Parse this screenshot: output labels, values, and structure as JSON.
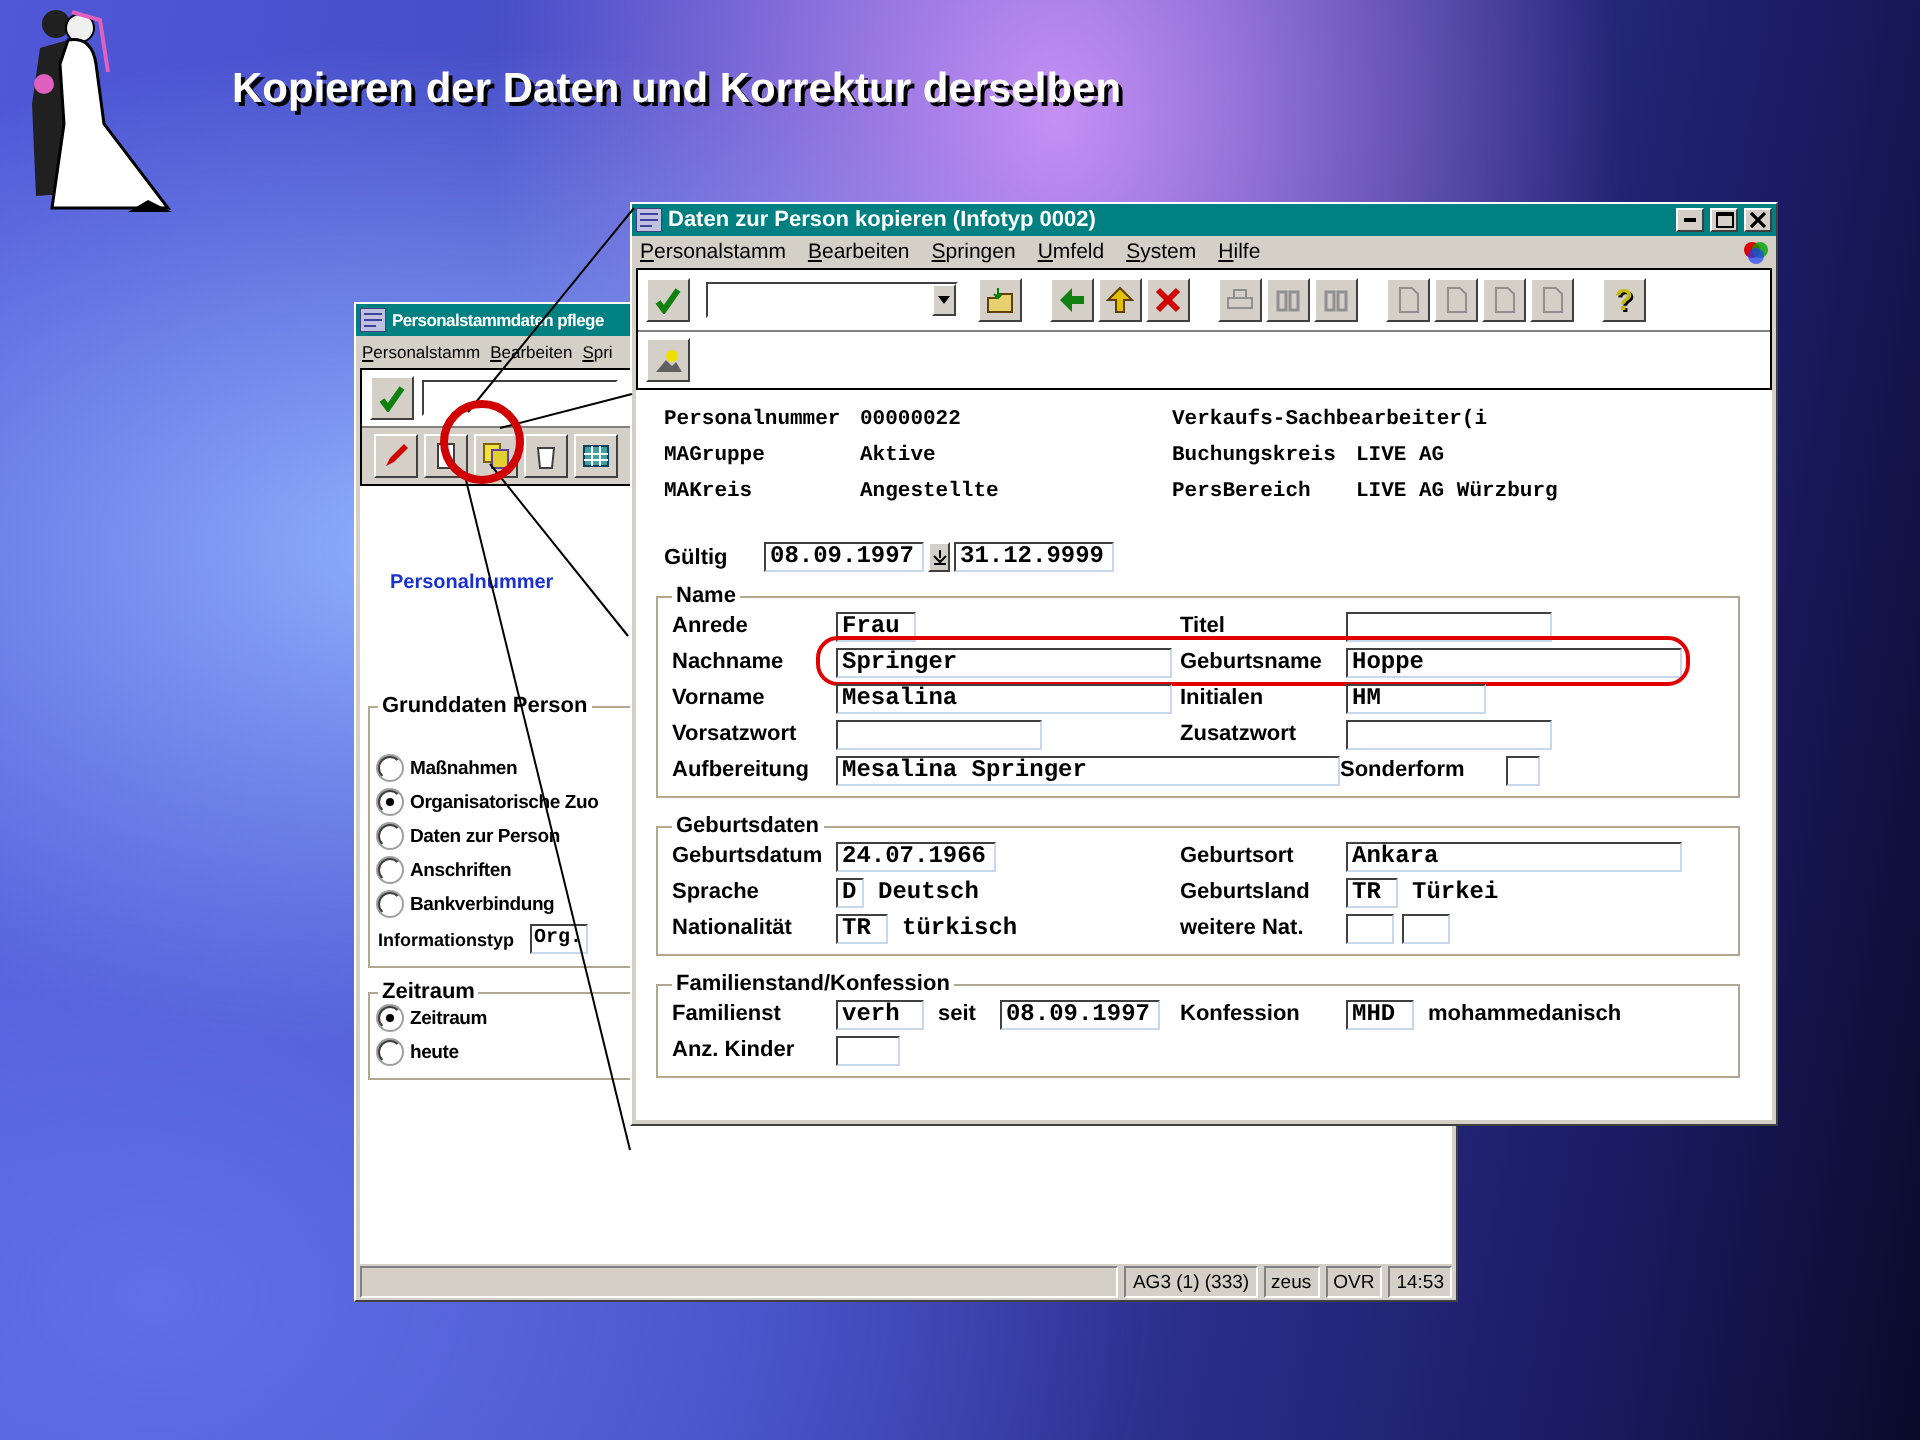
{
  "slide_title": "Kopieren der Daten und Korrektur derselben",
  "back_window": {
    "title": "Personalstammdaten pflege",
    "menu": [
      "Personalstamm",
      "Bearbeiten",
      "Spri"
    ],
    "key_label": "Personalnummer",
    "groups": [
      {
        "title": "Grunddaten Person",
        "options": [
          {
            "label": "Maßnahmen",
            "selected": false
          },
          {
            "label": "Organisatorische Zuo",
            "selected": true
          },
          {
            "label": "Daten zur Person",
            "selected": false
          },
          {
            "label": "Anschriften",
            "selected": false
          },
          {
            "label": "Bankverbindung",
            "selected": false
          }
        ],
        "field": {
          "label": "Informationstyp",
          "value": "Org."
        }
      },
      {
        "title": "Zeitraum",
        "options": [
          {
            "label": "Zeitraum",
            "selected": true
          },
          {
            "label": "heute",
            "selected": false
          }
        ]
      }
    ],
    "status_bar": [
      "AG3 (1) (333)",
      "zeus",
      "OVR",
      "14:53"
    ]
  },
  "front_window": {
    "title": "Daten zur Person kopieren (Infotyp 0002)",
    "menu": [
      "Personalstamm",
      "Bearbeiten",
      "Springen",
      "Umfeld",
      "System",
      "Hilfe"
    ],
    "help_button": "?",
    "header": [
      {
        "label": "Personalnummer",
        "value": "00000022",
        "label_2": "Verkaufs-Sachbearbeiter(i"
      },
      {
        "label": "MAGruppe",
        "value": "Aktive",
        "label_2": "Buchungskreis",
        "value_2": "LIVE AG"
      },
      {
        "label": "MAKreis",
        "value": "Angestellte",
        "label_2": "PersBereich",
        "value_2": "LIVE AG Würzburg"
      }
    ],
    "validity": {
      "label": "Gültig",
      "from": "08.09.1997",
      "to": "31.12.9999"
    },
    "groups": [
      {
        "title": "Name",
        "rows": [
          {
            "highlighted": false,
            "left": [
              {
                "kind": "label",
                "text": "Anrede"
              },
              {
                "kind": "field",
                "value": "Frau"
              }
            ],
            "right": [
              {
                "kind": "label",
                "text": "Titel"
              },
              {
                "kind": "field"
              }
            ]
          },
          {
            "highlighted": true,
            "left": [
              {
                "kind": "label",
                "text": "Nachname"
              },
              {
                "kind": "field",
                "value": "Springer"
              }
            ],
            "right": [
              {
                "kind": "label",
                "text": "Geburtsname"
              },
              {
                "kind": "field",
                "value": "Hoppe"
              }
            ]
          },
          {
            "highlighted": false,
            "left": [
              {
                "kind": "label",
                "text": "Vorname"
              },
              {
                "kind": "field",
                "value": "Mesalina"
              }
            ],
            "right": [
              {
                "kind": "label",
                "text": "Initialen"
              },
              {
                "kind": "field",
                "value": "HM"
              }
            ]
          },
          {
            "highlighted": false,
            "left": [
              {
                "kind": "label",
                "text": "Vorsatzwort"
              },
              {
                "kind": "field"
              }
            ],
            "right": [
              {
                "kind": "label",
                "text": "Zusatzwort"
              },
              {
                "kind": "field"
              }
            ]
          },
          {
            "highlighted": false,
            "left": [
              {
                "kind": "label",
                "text": "Aufbereitung"
              },
              {
                "kind": "field",
                "value": "Mesalina Springer"
              }
            ],
            "right": [
              {
                "kind": "label",
                "text": "Sonderform"
              },
              {
                "kind": "field"
              }
            ]
          }
        ]
      },
      {
        "title": "Geburtsdaten",
        "rows": [
          {
            "highlighted": false,
            "left": [
              {
                "kind": "label",
                "text": "Geburtsdatum"
              },
              {
                "kind": "field",
                "value": "24.07.1966"
              }
            ],
            "right": [
              {
                "kind": "label",
                "text": "Geburtsort"
              },
              {
                "kind": "field",
                "value": "Ankara"
              }
            ]
          },
          {
            "highlighted": false,
            "left": [
              {
                "kind": "label",
                "text": "Sprache"
              },
              {
                "kind": "field",
                "value": "D"
              },
              {
                "kind": "text",
                "text": "Deutsch"
              }
            ],
            "right": [
              {
                "kind": "label",
                "text": "Geburtsland"
              },
              {
                "kind": "field",
                "value": "TR"
              },
              {
                "kind": "text",
                "text": "Türkei"
              }
            ]
          },
          {
            "highlighted": false,
            "left": [
              {
                "kind": "label",
                "text": "Nationalität"
              },
              {
                "kind": "field",
                "value": "TR"
              },
              {
                "kind": "text",
                "text": "türkisch"
              }
            ],
            "right": [
              {
                "kind": "label",
                "text": "weitere Nat."
              },
              {
                "kind": "field"
              },
              {
                "kind": "field"
              }
            ]
          }
        ]
      },
      {
        "title": "Familienstand/Konfession",
        "rows": [
          {
            "highlighted": false,
            "left": [
              {
                "kind": "label",
                "text": "Familienst"
              },
              {
                "kind": "field",
                "value": "verh"
              },
              {
                "kind": "word",
                "text": "seit"
              },
              {
                "kind": "field",
                "value": "08.09.1997"
              }
            ],
            "right": [
              {
                "kind": "label",
                "text": "Konfession"
              },
              {
                "kind": "field",
                "value": "MHD"
              },
              {
                "kind": "word",
                "text": "mohammedanisch"
              }
            ]
          },
          {
            "highlighted": false,
            "left": [
              {
                "kind": "label",
                "text": "Anz. Kinder"
              },
              {
                "kind": "field"
              }
            ],
            "right": []
          }
        ]
      }
    ]
  }
}
